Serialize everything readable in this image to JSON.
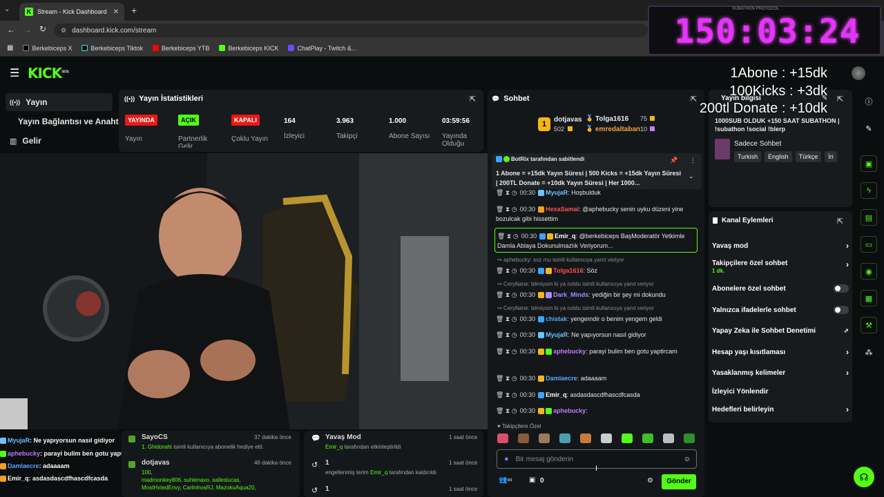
{
  "browser": {
    "tab_title": "Stream - Kick Dashboard",
    "url": "dashboard.kick.com/stream",
    "bookmarks": [
      "Berkebiceps X",
      "Berkebiceps Tiktok",
      "Berkebiceps YTB",
      "Berkebiceps KICK",
      "ChatPlay - Twitch &..."
    ]
  },
  "overlay": {
    "timer": "150:03:24",
    "timer_label": "SUBATHON PROTOCOL",
    "line1": "1Abone : +15dk",
    "line2": "100Kicks : +3dk",
    "line3": "200tl Donate : +10dk"
  },
  "header": {
    "logo": "KICK",
    "logo_sup": "BETA"
  },
  "sidebar": {
    "items": [
      {
        "label": "Yayın"
      },
      {
        "label": "Yayın Bağlantısı ve Anahtarı"
      },
      {
        "label": "Gelir"
      }
    ]
  },
  "stats": {
    "title": "Yayın İstatistikleri",
    "items": [
      {
        "value": "YAYINDA",
        "label": "Yayın"
      },
      {
        "value": "AÇIK",
        "label": "Partnerlik Gelir"
      },
      {
        "value": "KAPALI",
        "label": "Çoklu Yayın"
      },
      {
        "value": "164",
        "label": "İzleyici"
      },
      {
        "value": "3.963",
        "label": "Takipçi"
      },
      {
        "value": "1.000",
        "label": "Abone Sayısı"
      },
      {
        "value": "03:59:56",
        "label": "Yayında Olduğu"
      }
    ]
  },
  "chat": {
    "title": "Sohbet",
    "top_user": {
      "name": "dotjavas",
      "count": "502",
      "rank": "1"
    },
    "leaders": [
      {
        "name": "Tolga1616",
        "count": "75"
      },
      {
        "name": "emredaltaban",
        "count": "10"
      }
    ],
    "pinned": {
      "by": "BotRix tarafından sabitlendi",
      "text": "1 Abone = +15dk Yayın Süresi | 500 Kicks = +15dk Yayın Süresi | 200TL Donate = +10dk Yayın Süresi | Her 1000..."
    },
    "messages": [
      {
        "time": "00:30",
        "user": "MyujaR",
        "text": "Hoşbulduk",
        "color": "#6ec1ff"
      },
      {
        "time": "00:30",
        "user": "HexaSamal",
        "text": "@aphebucky senin uyku düzeni yine bozulcak gibi hissettim",
        "color": "#ff4f4f"
      },
      {
        "time": "00:30",
        "user": "Emir_q",
        "text": "@berkebiceps BaşModeratör Yetkimle Damla Ablaya Dokunulmazlık Veriyorum...",
        "color": "#ffffff"
      },
      {
        "time": "00:30",
        "user": "Tolga1616",
        "text": "Söz",
        "color": "#ff4f4f",
        "reply": "aphebucky: soz mu isimli kullanıcıya yanıt veriyor"
      },
      {
        "time": "00:30",
        "user": "Dark_Minds",
        "text": "yediğin bir şey mi dokundu",
        "color": "#a78bff",
        "reply": "Cerylliane: bilmiyom ki ya noldu isimli kullanıcıya yanıt veriyor"
      },
      {
        "time": "00:30",
        "user": "chistak",
        "text": "yengemdir o benim yengem geldi",
        "color": "#53a7ff",
        "reply": "Cerylliane: bilmiyom ki ya noldu isimli kullanıcıya yanıt veriyor"
      },
      {
        "time": "00:30",
        "user": "MyujaR",
        "text": "Ne yapıyorsun nasıl gidiyor",
        "color": "#6ec1ff"
      },
      {
        "time": "00:30",
        "user": "aphebucky",
        "text": "parayi bulim ben gotu yaptircam",
        "color": "#c07bff"
      },
      {
        "time": "00:30",
        "user": "Damlaecre",
        "text": "adaaaam",
        "color": "#5aa9ff"
      },
      {
        "time": "00:30",
        "user": "Emir_q",
        "text": "asdasdascdfhascdfcasda",
        "color": "#ffffff"
      },
      {
        "time": "00:30",
        "user": "aphebucky",
        "text": "",
        "color": "#c07bff"
      }
    ],
    "followers_only": "Takipçilere Özel",
    "input_placeholder": "Bir mesaj gönderin",
    "send_label": "Gönder",
    "count": "0"
  },
  "stream_info": {
    "title": "Yayın bilgisi",
    "stream_title": "1000SUB OLDUK +150 SAAT SUBATHON | !subathon !social !blerp",
    "category": "Sadece Sohbet",
    "tags": [
      "Turkish",
      "English",
      "Türkçe",
      "İri"
    ]
  },
  "channel_actions": {
    "title": "Kanal Eylemleri",
    "items": [
      {
        "label": "Yavaş mod",
        "kind": "arrow"
      },
      {
        "label": "Takipçilere özel sohbet",
        "sub": "1 dk.",
        "kind": "arrow"
      },
      {
        "label": "Abonelere özel sohbet",
        "kind": "toggle"
      },
      {
        "label": "Yalnızca ifadelerle sohbet",
        "kind": "toggle"
      },
      {
        "label": "Yapay Zeka ile Sohbet Denetimi",
        "kind": "external"
      },
      {
        "label": "Hesap yaşı kısıtlaması",
        "kind": "arrow"
      },
      {
        "label": "Yasaklanmış kelimeler",
        "kind": "arrow"
      },
      {
        "label": "İzleyici Yönlendir",
        "kind": "none"
      },
      {
        "label": "Hedefleri belirleyin",
        "kind": "arrow"
      }
    ]
  },
  "activity": {
    "left": [
      {
        "user": "SayoCS",
        "time": "37 dakika önce",
        "detail_user": "1. Ghidoraht",
        "detail": "isimli kullanıcıya abonelik hediye etti."
      },
      {
        "user": "dotjavas",
        "time": "46 dakika önce",
        "detail_user": "100,",
        "detail": "madmonkey806, suhlenaxo, salleslucas, MostHxtedEnvy, CarlinhosRJ, MazokuAqua20,"
      }
    ],
    "right": [
      {
        "title": "Yavaş Mod",
        "time": "1 saat önce",
        "detail_user": "Emir_q",
        "detail": "tarafından etkinleştirildi"
      },
      {
        "title": "1",
        "time": "1 saat önce",
        "detail_pre": "engellenmiş terim",
        "detail_user": "Emir_q",
        "detail": "tarafından kaldırıldı"
      },
      {
        "title": "1",
        "time": "1 saat önce"
      }
    ]
  },
  "stream_chat_overlay": [
    {
      "user": "MyujaR",
      "text": ": Ne yapıyorsun nasıl gidiyor",
      "color": "#6ec1ff"
    },
    {
      "user": "aphebucky",
      "text": ": parayi bulim ben gotu yaptircam",
      "color": "#c07bff"
    },
    {
      "user": "Damlaecre",
      "text": ": adaaaam",
      "color": "#5aa9ff"
    },
    {
      "user": "Emir_q",
      "text": ": asdasdascdfhascdfcasda",
      "color": "#ffffff"
    }
  ]
}
